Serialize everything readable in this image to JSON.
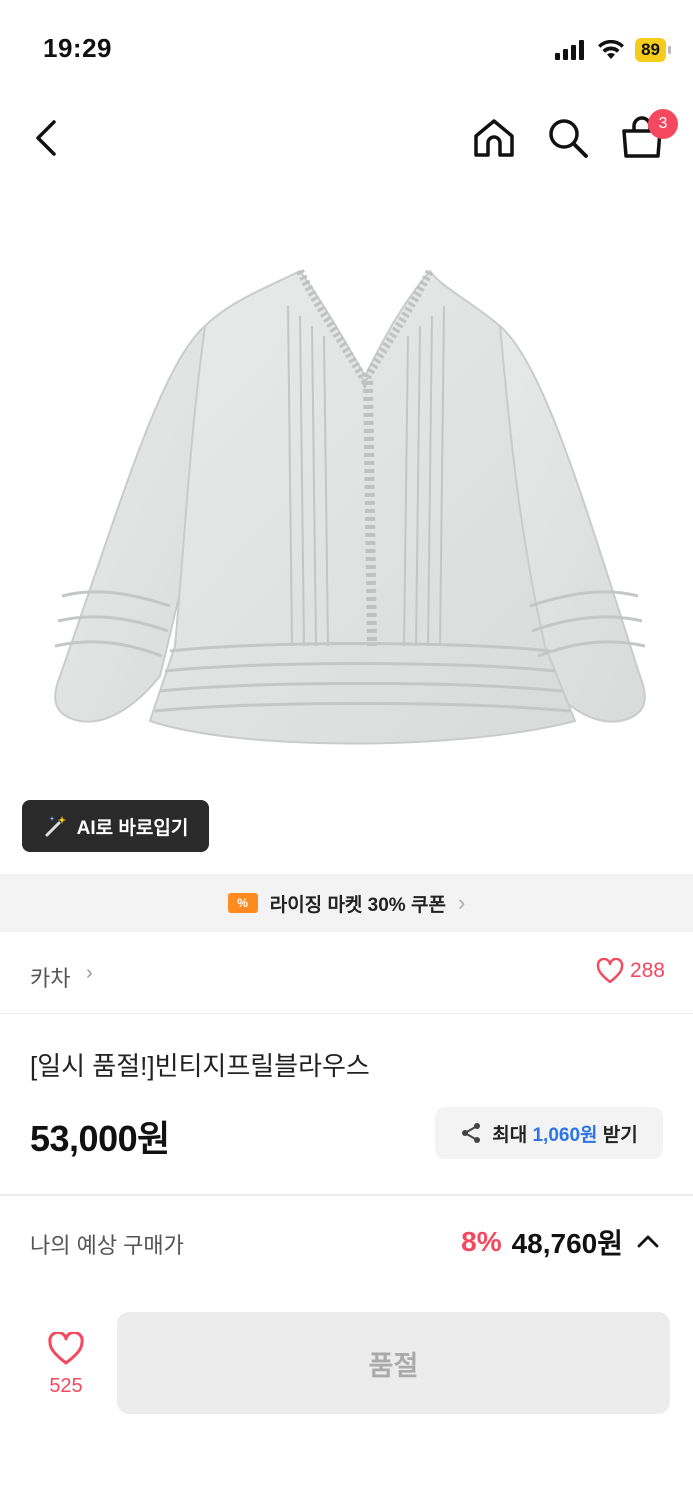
{
  "status": {
    "time": "19:29",
    "battery": "89"
  },
  "nav": {
    "cart_count": "3"
  },
  "ai_button": {
    "label": "AI로 바로입기"
  },
  "coupon": {
    "label": "라이징 마켓 30% 쿠폰",
    "icon": "%"
  },
  "brand": {
    "name": "카차",
    "likes": "288"
  },
  "product": {
    "title": "[일시 품절!]빈티지프릴블라우스",
    "price": "53,000원",
    "reward_prefix": "최대",
    "reward_amount": "1,060원",
    "reward_suffix": "받기"
  },
  "expected": {
    "label": "나의 예상 구매가",
    "discount": "8%",
    "price": "48,760원"
  },
  "bottom": {
    "favorites": "525",
    "button_label": "품절"
  },
  "colors": {
    "accent": "#f5485e",
    "blue": "#2a74e8",
    "coupon": "#ff8a1f",
    "battery": "#f5cc1b"
  }
}
